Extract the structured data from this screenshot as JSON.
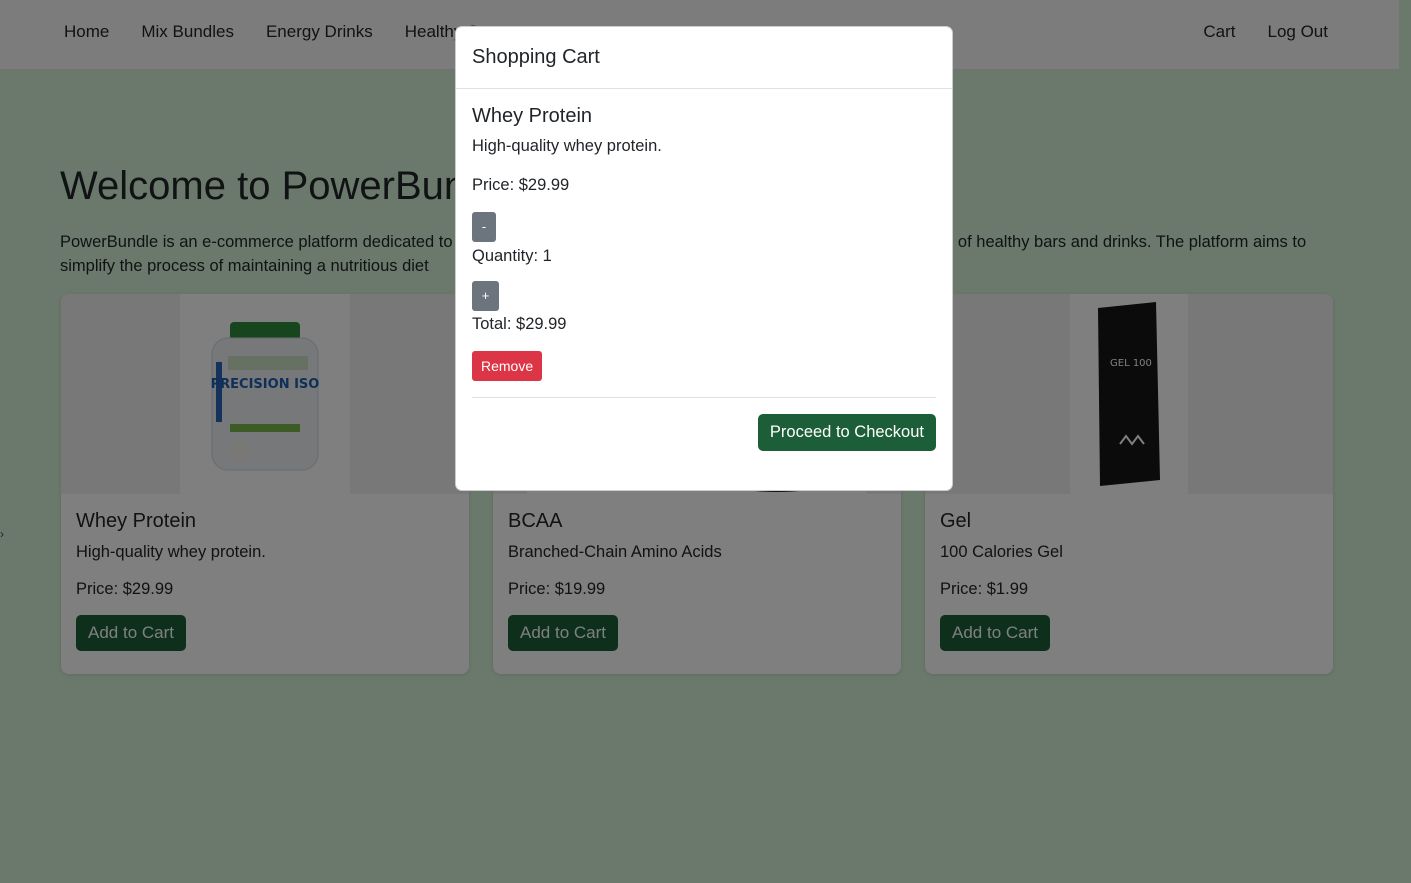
{
  "nav": {
    "left": [
      "Home",
      "Mix Bundles",
      "Energy Drinks",
      "Healthy S"
    ],
    "right": [
      "Cart",
      "Log Out"
    ]
  },
  "main": {
    "title": "Welcome to PowerBundle",
    "description": "PowerBundle is an e-commerce platform dedicated to providing athletes and health enthusiasts with customizable bundles of healthy bars and drinks. The platform aims to simplify the process of maintaining a nutritious diet"
  },
  "products": [
    {
      "name": "Whey Protein",
      "description": "High-quality whey protein.",
      "price": "Price: $29.99",
      "button": "Add to Cart",
      "image_label": "PRECISION ISO"
    },
    {
      "name": "BCAA",
      "description": "Branched-Chain Amino Acids",
      "price": "Price: $19.99",
      "button": "Add to Cart",
      "image_label": ""
    },
    {
      "name": "Gel",
      "description": "100 Calories Gel",
      "price": "Price: $1.99",
      "button": "Add to Cart",
      "image_label": "GEL 100"
    }
  ],
  "cart_modal": {
    "title": "Shopping Cart",
    "item": {
      "name": "Whey Protein",
      "description": "High-quality whey protein.",
      "price": "Price: $29.99",
      "decrease": "-",
      "quantity": "Quantity: 1",
      "increase": "+",
      "total": "Total: $29.99",
      "remove": "Remove"
    },
    "checkout": "Proceed to Checkout"
  },
  "colors": {
    "background": "#d6f2d9",
    "primary": "#1b5e38",
    "danger": "#dc3545",
    "secondary": "#6c757d"
  }
}
